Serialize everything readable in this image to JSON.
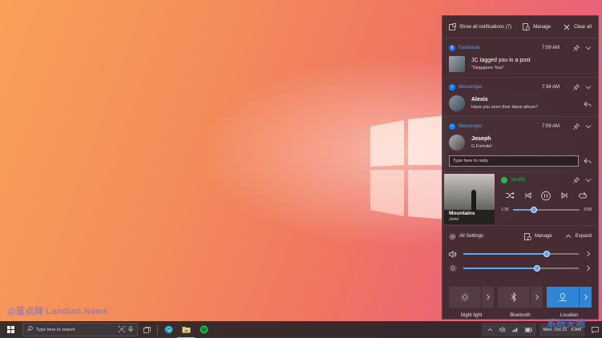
{
  "watermark": "@蓝点网 Landian.News",
  "watermark_right": "系统天地",
  "header": {
    "show_all": "Show all notifications (7)",
    "manage": "Manage",
    "clear_all": "Clear all"
  },
  "notifications": [
    {
      "app": "Facebook",
      "time": "7:09 AM",
      "title": "JC tagged you in a post",
      "sub": "\"Singapore Tour\""
    },
    {
      "app": "Messenger",
      "time": "7:34 AM",
      "title": "Alexis",
      "sub": "Have you seen their latest album?"
    },
    {
      "app": "Messenger",
      "time": "7:09 AM",
      "title": "Joseph",
      "sub": "G Fortnite!",
      "reply_placeholder": "Type here to reply"
    }
  ],
  "spotify": {
    "app": "Spotify",
    "album_title": "Mountains",
    "album_artist": "Jome",
    "elapsed": "1:35",
    "duration": "3:39",
    "progress": 0.32
  },
  "quick_settings": {
    "all_settings": "All Settings",
    "manage": "Manage",
    "expand": "Expand",
    "volume": 0.72,
    "brightness": 0.64,
    "tiles": [
      {
        "label": "Night light",
        "icon": "sun-icon",
        "active": false
      },
      {
        "label": "Bluetooth",
        "icon": "bluetooth-icon",
        "active": false
      },
      {
        "label": "Location",
        "icon": "location-icon",
        "active": true
      }
    ]
  },
  "taskbar": {
    "search_placeholder": "Type here to search",
    "clock": "Mon, Oct 21",
    "clock_right": "5 AM"
  },
  "colors": {
    "accent": "#2f86d6",
    "spotify": "#1db954",
    "facebook": "#1877f2"
  }
}
